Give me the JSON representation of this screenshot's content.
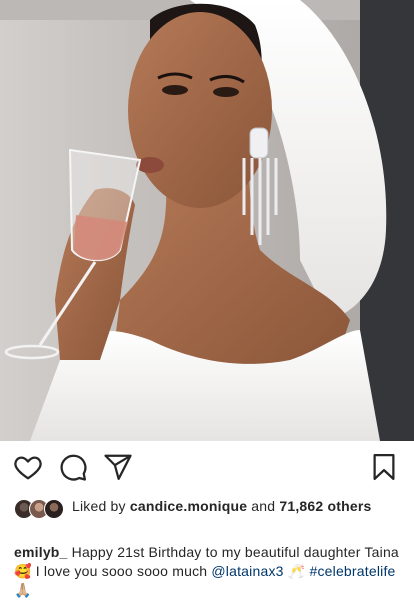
{
  "post": {
    "likes": {
      "prefix": "Liked by",
      "first_liker": "candice.monique",
      "connector": "and",
      "count": "71,862",
      "suffix": "others"
    },
    "caption": {
      "username": "emilyb_",
      "text_1": "Happy 21st Birthday to my beautiful daughter Taina",
      "emoji_1": "🥰",
      "text_2": "I love you sooo sooo much",
      "mention": "@latainax3",
      "emoji_2": "🥂",
      "hashtag": "#celebratelife",
      "emoji_3": "🙏🏼"
    }
  },
  "icons": [
    "heart-icon",
    "comment-icon",
    "share-icon",
    "bookmark-icon"
  ],
  "colors": {
    "text": "#262626",
    "link": "#00376b",
    "background": "#ffffff"
  }
}
